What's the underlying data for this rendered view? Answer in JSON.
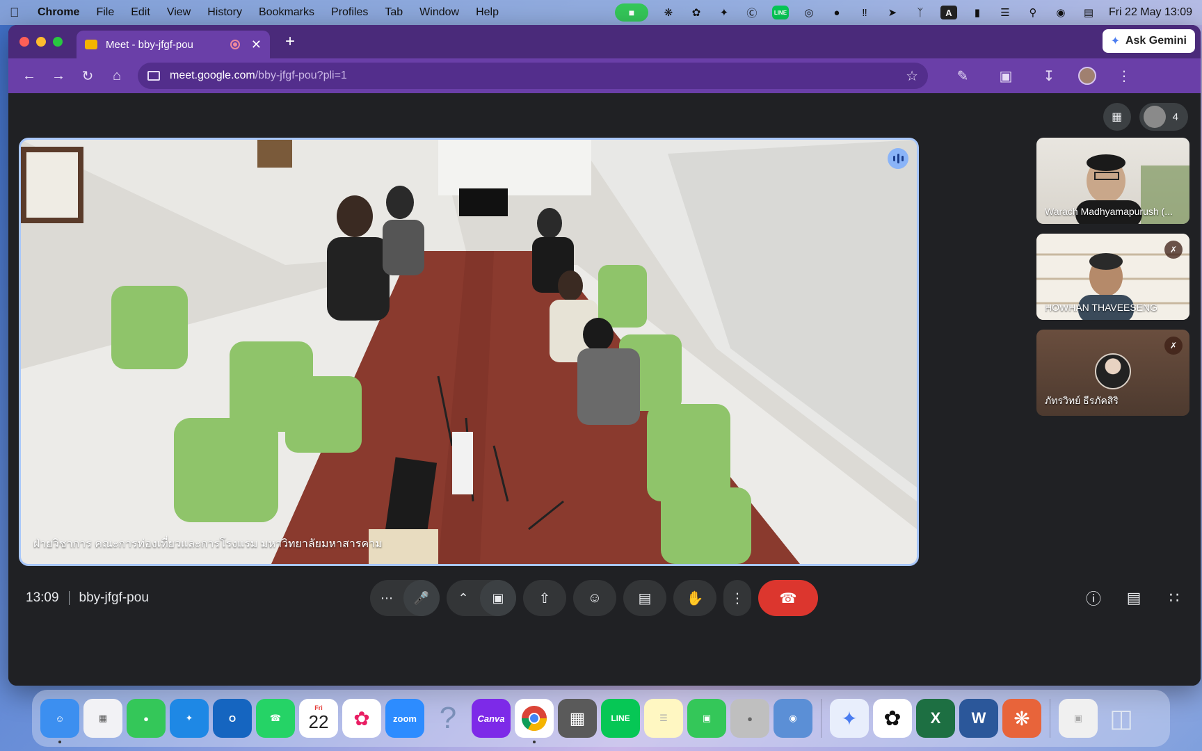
{
  "menubar": {
    "app": "Chrome",
    "items": [
      "File",
      "Edit",
      "View",
      "History",
      "Bookmarks",
      "Profiles",
      "Tab",
      "Window",
      "Help"
    ],
    "clock": "Fri 22 May  13:09",
    "line_label": "LINE",
    "a_label": "A"
  },
  "browser": {
    "tab_title": "Meet - bby-jfgf-pou",
    "ask_gemini": "Ask Gemini",
    "url_host": "meet.google.com",
    "url_path": "/bby-jfgf-pou?pli=1"
  },
  "meet": {
    "participant_count": "4",
    "main_participant": "ฝ่ายวิชาการ คณะการท่องเที่ยวและการโรงแรม มหาวิทยาลัยมหาสารคาม",
    "tiles": [
      {
        "name": "Warach Madhyamapurush (..."
      },
      {
        "name": "HOWHAN THAVEESENG"
      },
      {
        "name": "ภัทรวิทย์ ธีรภัคสิริ"
      }
    ],
    "time": "13:09",
    "meeting_code": "bby-jfgf-pou"
  },
  "dock": {
    "zoom_label": "zoom",
    "canva_label": "Canva",
    "calendar_month": "Fri",
    "calendar_day": "22",
    "help_label": "?",
    "line_label": "LINE",
    "excel_label": "X",
    "word_label": "W",
    "outlook_label": "O"
  },
  "colors": {
    "tab_bar": "#4a2a7a",
    "toolbar": "#6a3fa8",
    "meet_bg": "#202124",
    "end_call": "#dc362e",
    "active_speaker_border": "#a8c7fa"
  }
}
